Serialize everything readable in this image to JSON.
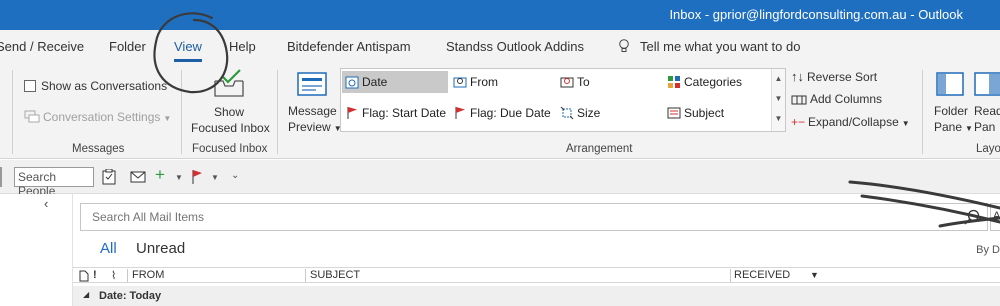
{
  "window": {
    "title": "Inbox - gprior@lingfordconsulting.com.au  -  Outlook"
  },
  "menu": {
    "items": [
      "Send / Receive",
      "Folder",
      "View",
      "Help",
      "Bitdefender Antispam",
      "Standss Outlook Addins"
    ],
    "tell_me": "Tell me what you want to do"
  },
  "ribbon": {
    "messages": {
      "show_as_conversations": "Show as Conversations",
      "conversation_settings": "Conversation Settings",
      "label": "Messages"
    },
    "focused_inbox": {
      "button_line1": "Show",
      "button_line2": "Focused Inbox",
      "label": "Focused Inbox"
    },
    "message_preview": {
      "line1": "Message",
      "line2": "Preview"
    },
    "arrangement": {
      "label": "Arrangement",
      "items": [
        "Date",
        "From",
        "To",
        "Categories",
        "Flag: Start Date",
        "Flag: Due Date",
        "Size",
        "Subject"
      ],
      "reverse_sort": "Reverse Sort",
      "add_columns": "Add Columns",
      "expand_collapse": "Expand/Collapse"
    },
    "layout": {
      "folder_pane_1": "Folder",
      "folder_pane_2": "Pane",
      "reading_pane_1": "Read",
      "reading_pane_2": "Pan",
      "label": "Layo"
    }
  },
  "quick_access": {
    "search_people": "Search People"
  },
  "mail": {
    "search_placeholder": "Search All Mail Items",
    "scope": "A",
    "filters": {
      "all": "All",
      "unread": "Unread"
    },
    "sort_hint": "By D",
    "columns": {
      "from": "FROM",
      "subject": "SUBJECT",
      "received": "RECEIVED"
    },
    "group_header": "Date: Today"
  },
  "colors": {
    "title_bar": "#1f6fc0",
    "accent": "#1d5fa6",
    "selected_item": "#c9c9c9",
    "flag": "#d32f2f",
    "green": "#2e9a3e"
  }
}
